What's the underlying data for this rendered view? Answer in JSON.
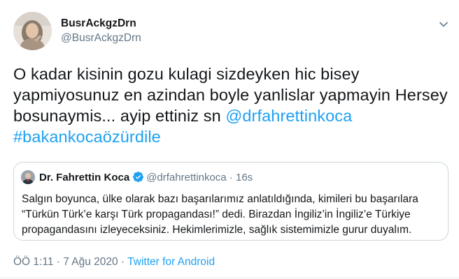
{
  "author": {
    "display_name": "BusrAckgzDrn",
    "handle": "@BusrAckgzDrn",
    "avatar_icon": "user-avatar-photo"
  },
  "menu_icon": "chevron-down-icon",
  "tweet": {
    "text_before_links": "O kadar kisinin gozu kulagi sizdeyken hic bisey yapmiyosunuz en azindan boyle yanlislar yapmayin Hersey bosunaymis... ayip ettiniz sn ",
    "mention": "@drfahrettinkoca",
    "hashtag": "#bakankocaözürdile"
  },
  "quoted_tweet": {
    "display_name": "Dr. Fahrettin Koca",
    "verified_icon": "verified-badge-icon",
    "handle": "@drfahrettinkoca",
    "separator": "·",
    "time": "16s",
    "text": "Salgın boyunca, ülke olarak bazı başarılarımız anlatıldığında, kimileri bu başarılara “Türkün Türk’e karşı Türk propagandası!” dedi. Birazdan İngiliz’in İngiliz’e Türkiye propagandasını izleyeceksiniz. Hekimlerimizle, sağlık sistemimizle gurur duyalım."
  },
  "footer": {
    "time": "ÖÖ 1:11",
    "separator_1": " · ",
    "date": "7 Ağu 2020",
    "separator_2": " · ",
    "source": "Twitter for Android"
  },
  "colors": {
    "link": "#1da1f2",
    "secondary_text": "#657786",
    "border": "#ccd6dd"
  }
}
